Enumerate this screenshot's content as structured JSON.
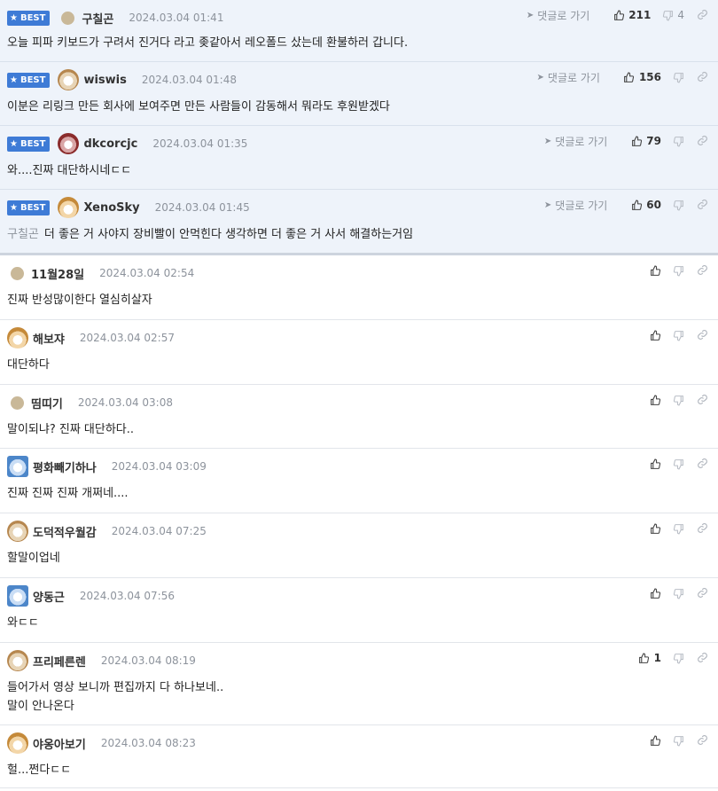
{
  "labels": {
    "best": "BEST",
    "reply": "댓글로 가기"
  },
  "colors": {
    "accent": "#3e7bd6",
    "best_bg": "#eef3fa"
  },
  "comments": [
    {
      "best": true,
      "nick": "구칠곤",
      "date": "2024.03.04 01:41",
      "text": "오늘 피파 키보드가 구려서 진거다 라고 좆같아서 레오폴드 샀는데 환불하러 갑니다.",
      "mention": "",
      "likes": "211",
      "dislikes": "4",
      "avatar": "plain"
    },
    {
      "best": true,
      "nick": "wiswis",
      "date": "2024.03.04 01:48",
      "text": "이분은 리링크 만든 회사에 보여주면 만든 사람들이 감동해서 뭐라도 후원받겠다",
      "mention": "",
      "likes": "156",
      "dislikes": "",
      "avatar": "dog"
    },
    {
      "best": true,
      "nick": "dkcorcjc",
      "date": "2024.03.04 01:35",
      "text": "와....진짜 대단하시네ㄷㄷ",
      "mention": "",
      "likes": "79",
      "dislikes": "",
      "avatar": "red"
    },
    {
      "best": true,
      "nick": "XenoSky",
      "date": "2024.03.04 01:45",
      "text": "더 좋은 거 사야지 장비빨이 안먹힌다 생각하면 더 좋은 거 사서 해결하는거임",
      "mention": "구칠곤",
      "likes": "60",
      "dislikes": "",
      "avatar": "fox"
    },
    {
      "best": false,
      "nick": "11월28일",
      "date": "2024.03.04 02:54",
      "text": "진짜 반성많이한다 열심히살자",
      "mention": "",
      "likes": "",
      "dislikes": "",
      "avatar": "plain"
    },
    {
      "best": false,
      "nick": "해보쟈",
      "date": "2024.03.04 02:57",
      "text": "대단하다",
      "mention": "",
      "likes": "",
      "dislikes": "",
      "avatar": "fox"
    },
    {
      "best": false,
      "nick": "띰띠기",
      "date": "2024.03.04 03:08",
      "text": "말이되냐? 진짜 대단하다..",
      "mention": "",
      "likes": "",
      "dislikes": "",
      "avatar": "plain"
    },
    {
      "best": false,
      "nick": "평화빼기하나",
      "date": "2024.03.04 03:09",
      "text": "진짜 진짜 진짜 개쩌네....",
      "mention": "",
      "likes": "",
      "dislikes": "",
      "avatar": "blue"
    },
    {
      "best": false,
      "nick": "도덕적우월감",
      "date": "2024.03.04 07:25",
      "text": "할말이업네",
      "mention": "",
      "likes": "",
      "dislikes": "",
      "avatar": "dog"
    },
    {
      "best": false,
      "nick": "양동근",
      "date": "2024.03.04 07:56",
      "text": "와ㄷㄷ",
      "mention": "",
      "likes": "",
      "dislikes": "",
      "avatar": "blue"
    },
    {
      "best": false,
      "nick": "프리페른렌",
      "date": "2024.03.04 08:19",
      "text": "들어가서 영상 보니까 편집까지 다 하나보네..",
      "text2": "말이 안나온다",
      "mention": "",
      "likes": "1",
      "dislikes": "",
      "avatar": "dog"
    },
    {
      "best": false,
      "nick": "야옹아보기",
      "date": "2024.03.04 08:23",
      "text": "헐...쩐다ㄷㄷ",
      "mention": "",
      "likes": "",
      "dislikes": "",
      "avatar": "fox"
    }
  ]
}
